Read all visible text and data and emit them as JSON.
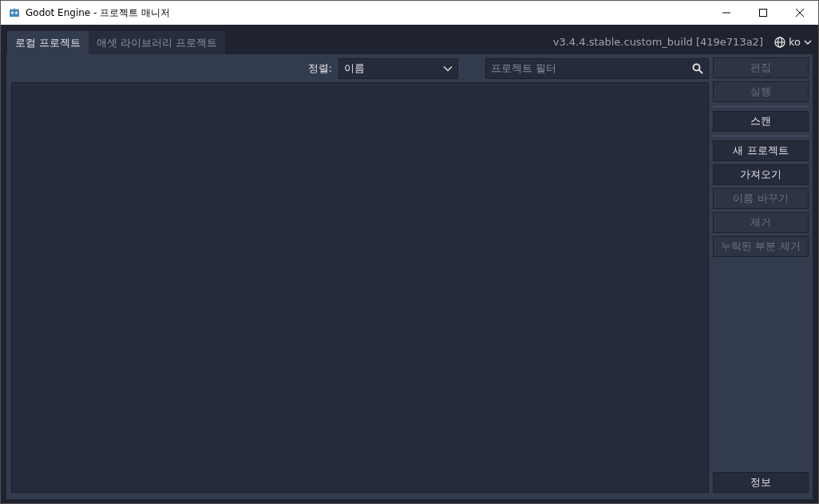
{
  "window": {
    "title": "Godot Engine - 프로젝트 매니저"
  },
  "tabs": [
    {
      "label": "로컬 프로젝트",
      "selected": true
    },
    {
      "label": "애셋 라이브러리 프로젝트",
      "selected": false
    }
  ],
  "version": "v3.4.4.stable.custom_build [419e713a2]",
  "language": "ko",
  "sort": {
    "label": "정렬:",
    "value": "이름"
  },
  "filter": {
    "placeholder": "프로젝트 필터"
  },
  "button_groups": [
    [
      {
        "label": "편집",
        "disabled": true
      },
      {
        "label": "실행",
        "disabled": true
      }
    ],
    [
      {
        "label": "스캔",
        "disabled": false
      }
    ],
    [
      {
        "label": "새 프로젝트",
        "disabled": false
      },
      {
        "label": "가져오기",
        "disabled": false
      },
      {
        "label": "이름 바꾸기",
        "disabled": true
      },
      {
        "label": "제거",
        "disabled": true
      },
      {
        "label": "누락된 부분 제거",
        "disabled": true
      }
    ]
  ],
  "about_button": {
    "label": "정보",
    "disabled": false
  }
}
